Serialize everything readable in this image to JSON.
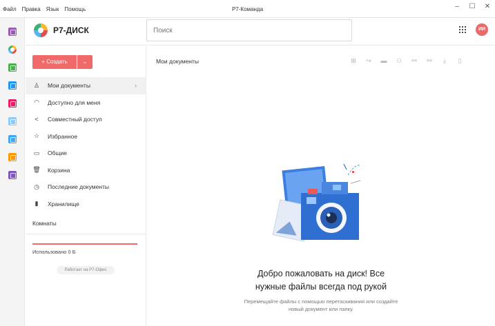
{
  "menubar": {
    "items": [
      "Файл",
      "Правка",
      "Язык",
      "Помощь"
    ]
  },
  "window": {
    "title": "Р7-Команда",
    "minimize": "–",
    "maximize": "☐",
    "close": "✕"
  },
  "rail": {
    "icons": [
      {
        "name": "chat-icon",
        "color": "#9b59b6"
      },
      {
        "name": "disk-icon",
        "color": "#f7b733"
      },
      {
        "name": "spreadsheet-icon",
        "color": "#4caf50"
      },
      {
        "name": "mail-icon",
        "color": "#2196f3"
      },
      {
        "name": "projects-icon",
        "color": "#e91e63"
      },
      {
        "name": "contacts-icon",
        "color": "#90caf9"
      },
      {
        "name": "tasks-icon",
        "color": "#42a5f5"
      },
      {
        "name": "calendar-icon",
        "color": "#ff9800"
      },
      {
        "name": "notes-icon",
        "color": "#7e57c2"
      }
    ]
  },
  "header": {
    "brand": "Р7-ДИСК",
    "search_placeholder": "Поиск",
    "avatar_initials": "ИИ"
  },
  "sidebar": {
    "create_label": "+ Создать",
    "create_dropdown": "⌄",
    "items": [
      {
        "label": "Мои документы",
        "icon": "person-icon",
        "glyph": "♙",
        "chevron": "›"
      },
      {
        "label": "Доступно для меня",
        "icon": "rss-icon",
        "glyph": "◠"
      },
      {
        "label": "Совместный доступ",
        "icon": "share-icon",
        "glyph": "<"
      },
      {
        "label": "Избранное",
        "icon": "star-icon",
        "glyph": "☆"
      },
      {
        "label": "Общие",
        "icon": "folder-icon",
        "glyph": "▭"
      },
      {
        "label": "Корзина",
        "icon": "trash-icon",
        "glyph": "🗑"
      },
      {
        "label": "Последние документы",
        "icon": "clock-icon",
        "glyph": "◷"
      },
      {
        "label": "Хранилище",
        "icon": "storage-icon",
        "glyph": "▮"
      }
    ],
    "rooms_label": "Комнаты",
    "used_label": "Использовано 0 Б",
    "powered_label": "Работает на Р7-Офис"
  },
  "content": {
    "breadcrumb": "Мои документы",
    "actions": [
      {
        "name": "new-item-icon",
        "glyph": "⊞"
      },
      {
        "name": "share-arrow-icon",
        "glyph": "↪"
      },
      {
        "name": "move-folder-icon",
        "glyph": "▬"
      },
      {
        "name": "access-icon",
        "glyph": "⚇"
      },
      {
        "name": "link-icon",
        "glyph": "⚯"
      },
      {
        "name": "copy-link-icon",
        "glyph": "⚯"
      },
      {
        "name": "download-icon",
        "glyph": "⤓"
      },
      {
        "name": "delete-icon",
        "glyph": "▯"
      }
    ],
    "welcome_title_line1": "Добро пожаловать на диск! Все",
    "welcome_title_line2": "нужные файлы всегда под рукой",
    "welcome_text": "Перемещайте файлы с помощью перетаскивания или создайте новый документ или папку."
  },
  "colors": {
    "accent": "#f06a6a",
    "avatar": "#e86a6a",
    "camera_blue": "#2f6fd1"
  }
}
